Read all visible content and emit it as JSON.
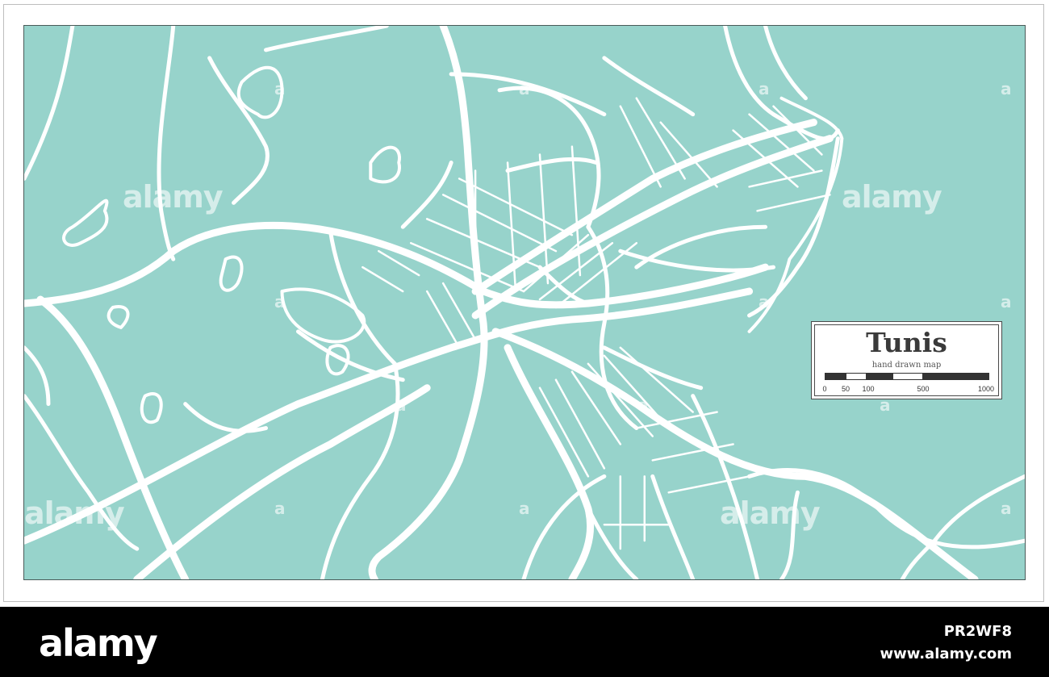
{
  "colors": {
    "water": "#97d3cb",
    "roads": "#ffffff",
    "border": "#4a5a58",
    "bar": "#000000"
  },
  "legend": {
    "title": "Tunis",
    "subtitle": "hand drawn map",
    "scale_labels": [
      "0",
      "50",
      "100",
      "500",
      "1000"
    ]
  },
  "watermark": {
    "text": "alamy",
    "mark": "a"
  },
  "footer": {
    "brand": "alamy",
    "image_id": "PR2WF8",
    "site": "www.alamy.com"
  }
}
